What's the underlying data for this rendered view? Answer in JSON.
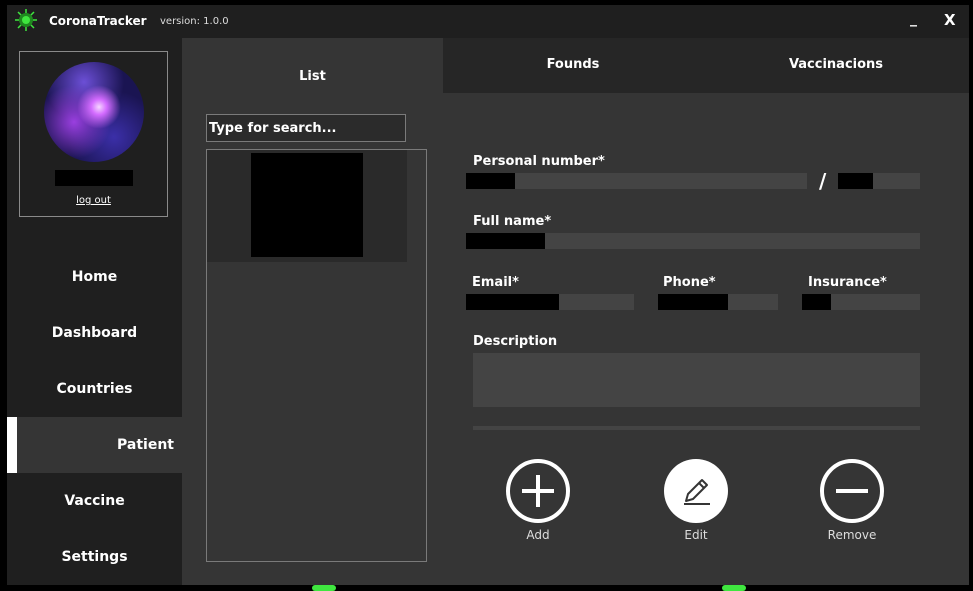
{
  "app": {
    "title": "CoronaTracker",
    "version": "version: 1.0.0",
    "minimize_label": "_",
    "close_label": "X"
  },
  "profile": {
    "logout_label": "log out"
  },
  "sidebar": {
    "items": [
      {
        "label": "Home",
        "active": false
      },
      {
        "label": "Dashboard",
        "active": false
      },
      {
        "label": "Countries",
        "active": false
      },
      {
        "label": "Patient",
        "active": true
      },
      {
        "label": "Vaccine",
        "active": false
      },
      {
        "label": "Settings",
        "active": false
      }
    ]
  },
  "tabs": [
    {
      "label": "List",
      "active": true
    },
    {
      "label": "Founds",
      "active": false
    },
    {
      "label": "Vaccinacions",
      "active": false
    }
  ],
  "list": {
    "search_placeholder": "Type for search..."
  },
  "form": {
    "personal_number_label": "Personal number*",
    "separator": "/",
    "full_name_label": "Full name*",
    "email_label": "Email*",
    "phone_label": "Phone*",
    "insurance_label": "Insurance*",
    "description_label": "Description"
  },
  "actions": {
    "add_label": "Add",
    "edit_label": "Edit",
    "remove_label": "Remove"
  },
  "colors": {
    "sidebar_bg": "#1f1f1f",
    "panel_bg": "#353535",
    "field_bg": "#444444",
    "accent": "#ffffff",
    "logo_green": "#3fe63f"
  }
}
